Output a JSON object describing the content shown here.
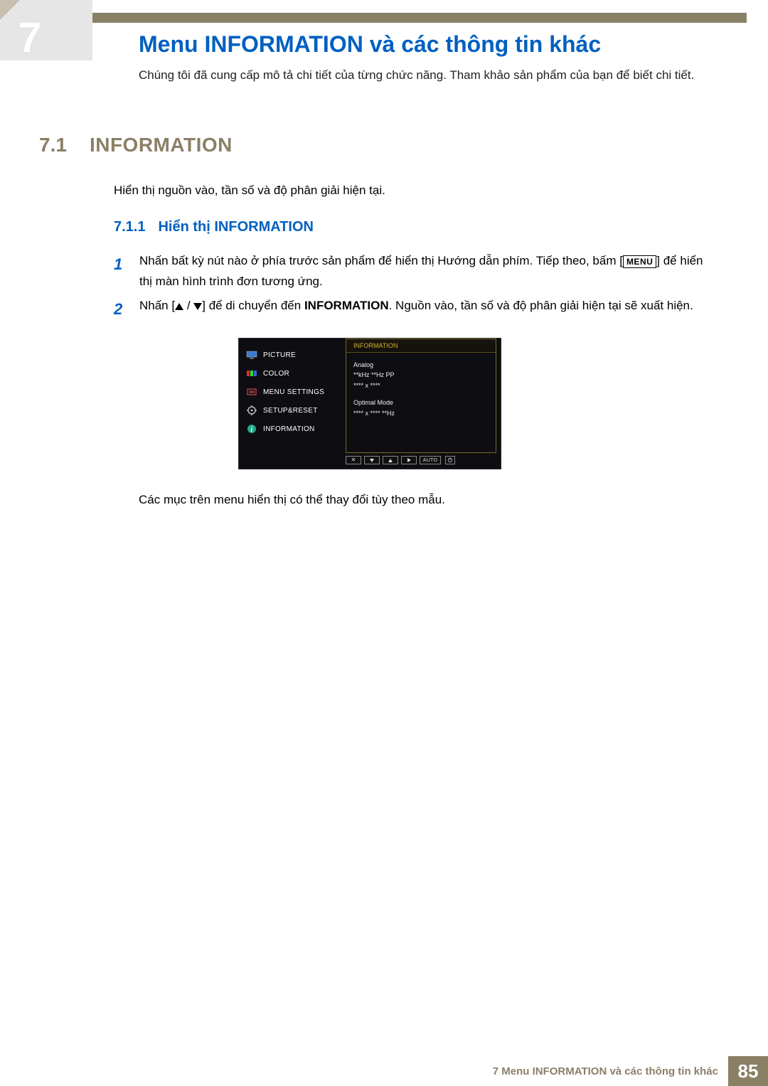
{
  "header": {
    "chapter_number": "7"
  },
  "title": "Menu INFORMATION và các thông tin khác",
  "intro": "Chúng tôi đã cung cấp mô tả chi tiết của từng chức năng. Tham khảo sản phẩm của bạn để biết chi tiết.",
  "h2": {
    "num": "7.1",
    "text": "INFORMATION"
  },
  "h2_desc": "Hiển thị nguồn vào, tần số và độ phân giải hiện tại.",
  "h3": {
    "num": "7.1.1",
    "text": "Hiển thị INFORMATION"
  },
  "steps": [
    {
      "num": "1",
      "text_before": "Nhấn bất kỳ nút nào ở phía trước sản phẩm để hiển thị Hướng dẫn phím. Tiếp theo, bấm [",
      "kbd": "MENU",
      "text_after": "] để hiển thị màn hình trình đơn tương ứng."
    },
    {
      "num": "2",
      "text_before": "Nhấn [",
      "text_mid": "] để di chuyển đến ",
      "strong": "INFORMATION",
      "text_after": ". Nguồn vào, tần số và độ phân giải hiện tại sẽ xuất hiện."
    }
  ],
  "osd": {
    "menu_items": [
      "PICTURE",
      "COLOR",
      "MENU SETTINGS",
      "SETUP&RESET",
      "INFORMATION"
    ],
    "panel_title": "INFORMATION",
    "panel_lines": [
      "Analog",
      "**kHz **Hz PP",
      "**** x ****",
      "",
      "Optimal Mode",
      "**** x **** **Hz"
    ],
    "buttons": {
      "auto": "AUTO"
    }
  },
  "note": "Các mục trên menu hiển thị có thể thay đổi tùy theo mẫu.",
  "footer": {
    "chapter": "7  Menu INFORMATION và các thông tin khác",
    "page": "85"
  }
}
